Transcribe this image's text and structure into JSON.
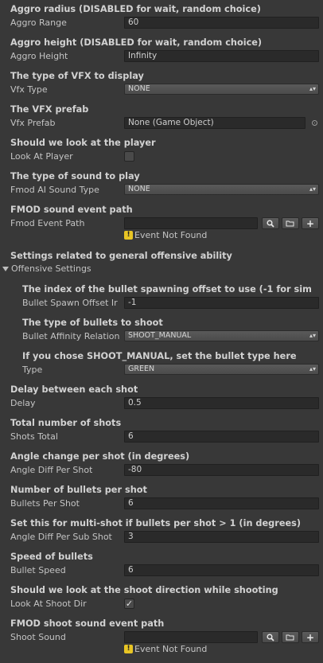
{
  "aggro_radius": {
    "header": "Aggro radius (DISABLED for wait, random choice)",
    "label": "Aggro Range",
    "value": "60"
  },
  "aggro_height": {
    "header": "Aggro height (DISABLED for wait, random choice)",
    "label": "Aggro Height",
    "value": "Infinity"
  },
  "vfx_type": {
    "header": "The type of VFX to display",
    "label": "Vfx Type",
    "value": "NONE"
  },
  "vfx_prefab": {
    "header": "The VFX prefab",
    "label": "Vfx Prefab",
    "value": "None (Game Object)"
  },
  "look_at_player": {
    "header": "Should we look at the player",
    "label": "Look At Player",
    "checked": false
  },
  "sound_type": {
    "header": "The type of sound to play",
    "label": "Fmod AI Sound Type",
    "value": "NONE"
  },
  "fmod_event": {
    "header": "FMOD sound event path",
    "label": "Fmod Event Path",
    "value": "",
    "warning": "Event Not Found"
  },
  "offensive": {
    "header": "Settings related to general offensive ability",
    "foldout_label": "Offensive Settings"
  },
  "bullet_spawn": {
    "header": "The index of the bullet spawning offset to use (-1 for sim",
    "label": "Bullet Spawn Offset Ir",
    "value": "-1"
  },
  "bullet_affinity": {
    "header": "The type of bullets to shoot",
    "label": "Bullet Affinity Relation",
    "value": "SHOOT_MANUAL"
  },
  "bullet_type": {
    "header": "If you chose SHOOT_MANUAL, set the bullet type here",
    "label": "Type",
    "value": "GREEN"
  },
  "delay": {
    "header": "Delay between each shot",
    "label": "Delay",
    "value": "0.5"
  },
  "shots_total": {
    "header": "Total number of shots",
    "label": "Shots Total",
    "value": "6"
  },
  "angle_diff": {
    "header": "Angle change per shot (in degrees)",
    "label": "Angle Diff Per Shot",
    "value": "-80"
  },
  "bullets_per_shot": {
    "header": "Number of bullets per shot",
    "label": "Bullets Per Shot",
    "value": "6"
  },
  "angle_sub": {
    "header": "Set this for multi-shot if bullets per shot > 1 (in degrees)",
    "label": "Angle Diff Per Sub Shot",
    "value": "3"
  },
  "bullet_speed": {
    "header": "Speed of bullets",
    "label": "Bullet Speed",
    "value": "6"
  },
  "look_at_shoot": {
    "header": "Should we look at the shoot direction while shooting",
    "label": "Look At Shoot Dir",
    "checked": true
  },
  "shoot_sound": {
    "header": "FMOD shoot sound event path",
    "label": "Shoot Sound",
    "value": "",
    "warning": "Event Not Found"
  },
  "icons": {
    "dropdown_arrow": "▴▾",
    "check": "✓",
    "warning": "!",
    "search": "search-icon",
    "folder": "folder-icon",
    "plus": "+"
  },
  "colors": {
    "background": "#383838",
    "field": "#2a2a2a",
    "warning": "#e8c524"
  }
}
